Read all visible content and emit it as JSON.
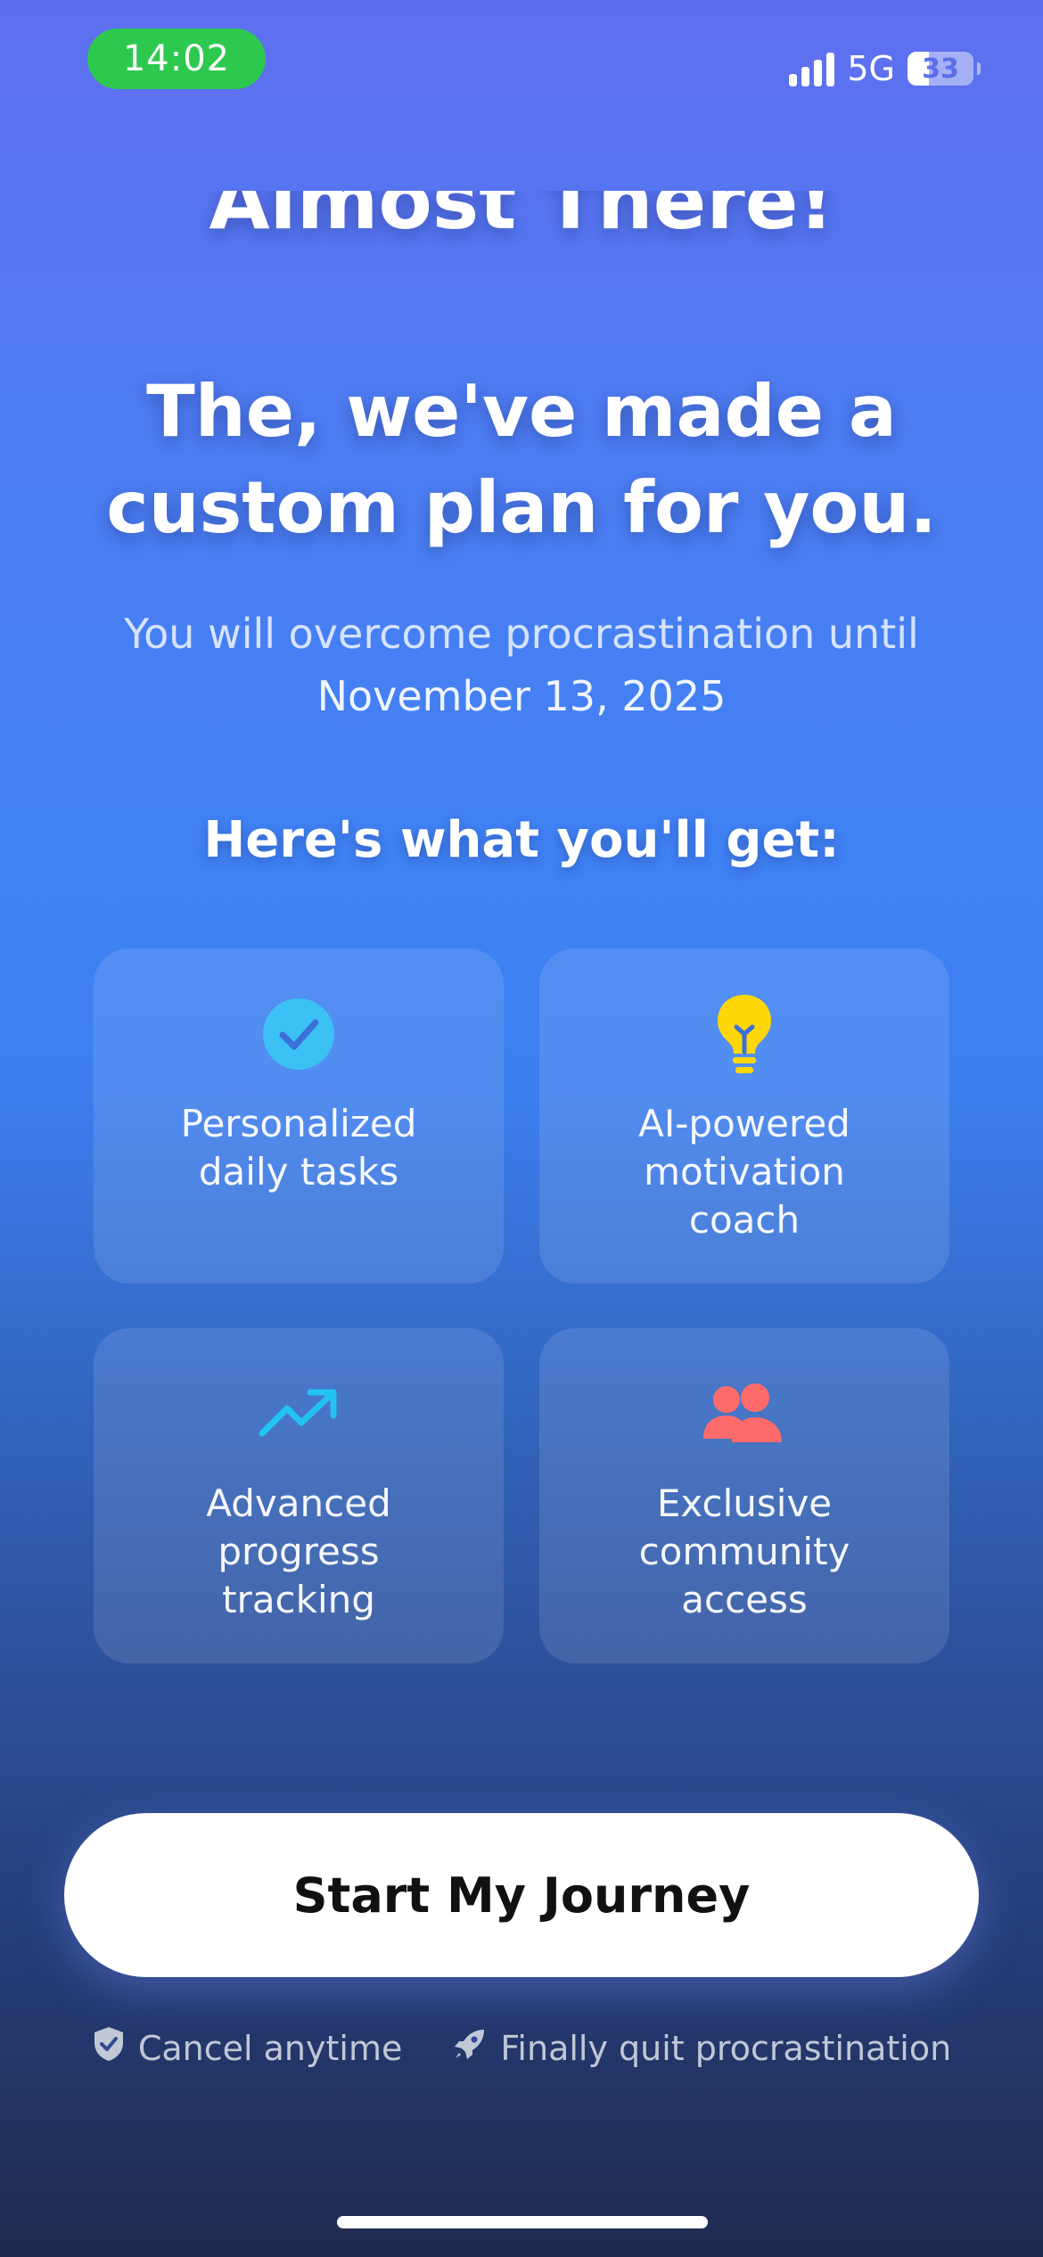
{
  "status_bar": {
    "time": "14:02",
    "network": "5G",
    "battery_level": "33",
    "battery_fraction": 0.33
  },
  "header": {
    "clipped_title": "Almost There!",
    "headline": "The, we've made a custom plan for you.",
    "subtitle": "You will overcome procrastination until",
    "date": "November 13, 2025"
  },
  "benefits": {
    "title": "Here's what you'll get:",
    "items": [
      {
        "label": "Personalized daily tasks",
        "icon": "check-circle-icon",
        "color": "#3cc1f4"
      },
      {
        "label": "AI-powered motivation coach",
        "icon": "lightbulb-icon",
        "color": "#ffd60a"
      },
      {
        "label": "Advanced progress tracking",
        "icon": "trending-up-icon",
        "color": "#22c3f0"
      },
      {
        "label": "Exclusive community access",
        "icon": "users-icon",
        "color": "#ff6b6b"
      }
    ]
  },
  "cta": {
    "label": "Start My Journey"
  },
  "assurances": [
    {
      "label": "Cancel anytime",
      "icon": "shield-check-icon"
    },
    {
      "label": "Finally quit procrastination",
      "icon": "rocket-icon"
    }
  ],
  "colors": {
    "status_pill": "#2dc94e",
    "gradient_top": "#5f6ef0",
    "gradient_bottom": "#1f2a4e"
  }
}
